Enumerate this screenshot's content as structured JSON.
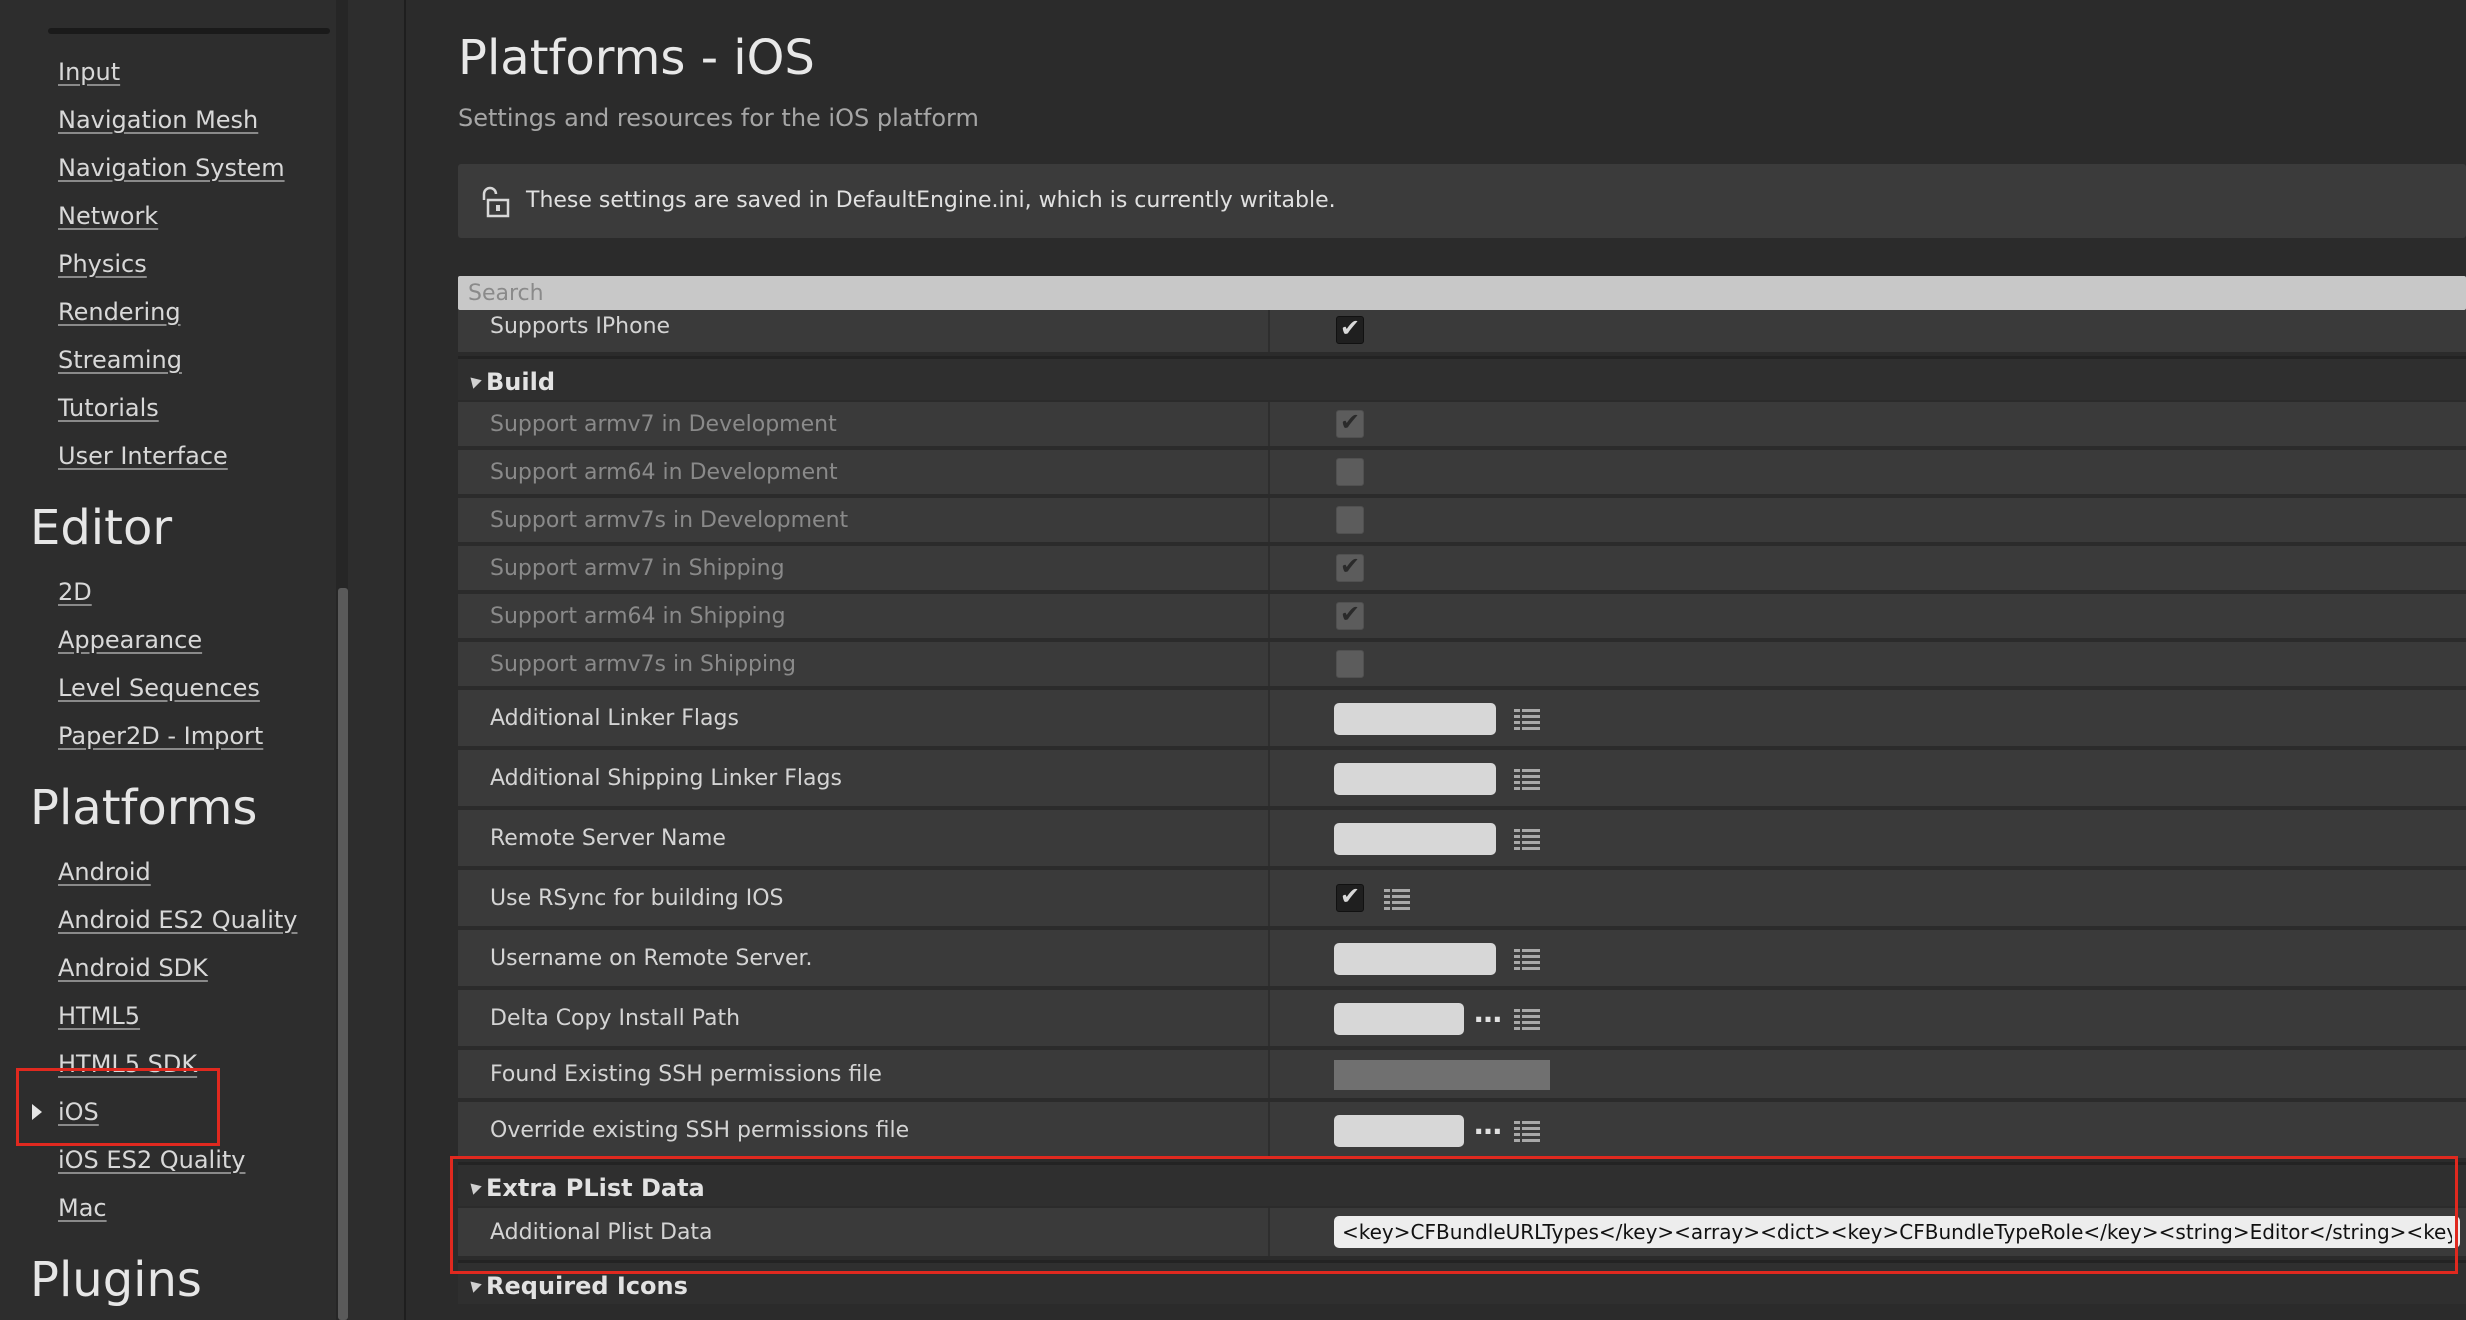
{
  "sidebar": {
    "groups": [
      {
        "category": "",
        "items": [
          "Input",
          "Navigation Mesh",
          "Navigation System",
          "Network",
          "Physics",
          "Rendering",
          "Streaming",
          "Tutorials",
          "User Interface"
        ]
      },
      {
        "category": "Editor",
        "items": [
          "2D",
          "Appearance",
          "Level Sequences",
          "Paper2D - Import"
        ]
      },
      {
        "category": "Platforms",
        "items": [
          "Android",
          "Android ES2 Quality",
          "Android SDK",
          "HTML5",
          "HTML5 SDK",
          "iOS",
          "iOS ES2 Quality",
          "Mac"
        ]
      },
      {
        "category": "Plugins",
        "items": []
      }
    ],
    "selected": "iOS"
  },
  "header": {
    "title": "Platforms - iOS",
    "subtitle": "Settings and resources for the iOS platform"
  },
  "notice": {
    "text": "These settings are saved in DefaultEngine.ini, which is currently writable.",
    "icon": "unlocked-lock-icon"
  },
  "search": {
    "placeholder": "Search"
  },
  "rows": {
    "supports_iphone": {
      "label": "Supports IPhone",
      "checked": true
    },
    "build": {
      "title": "Build",
      "armv7_dev": {
        "label": "Support armv7 in Development",
        "checked": true
      },
      "arm64_dev": {
        "label": "Support arm64 in Development",
        "checked": false
      },
      "armv7s_dev": {
        "label": "Support armv7s in Development",
        "checked": false
      },
      "armv7_ship": {
        "label": "Support armv7 in Shipping",
        "checked": true
      },
      "arm64_ship": {
        "label": "Support arm64 in Shipping",
        "checked": true
      },
      "armv7s_ship": {
        "label": "Support armv7s in Shipping",
        "checked": false
      },
      "linker_flags": {
        "label": "Additional Linker Flags",
        "value": ""
      },
      "ship_linker_flags": {
        "label": "Additional Shipping Linker Flags",
        "value": ""
      },
      "remote_server": {
        "label": "Remote Server Name",
        "value": ""
      },
      "rsync": {
        "label": "Use RSync for building IOS",
        "checked": true
      },
      "username": {
        "label": "Username on Remote Server.",
        "value": ""
      },
      "delta_copy": {
        "label": "Delta Copy Install Path",
        "value": ""
      },
      "ssh_found": {
        "label": "Found Existing SSH permissions file",
        "value": ""
      },
      "ssh_override": {
        "label": "Override existing SSH permissions file",
        "value": ""
      }
    },
    "extra_plist": {
      "title": "Extra PList Data",
      "additional": {
        "label": "Additional Plist Data",
        "value": "<key>CFBundleURLTypes</key><array><dict><key>CFBundleTypeRole</key><string>Editor</string><key>CFBund"
      }
    },
    "required_icons": {
      "title": "Required Icons"
    }
  },
  "colors": {
    "highlight_box": "#e0291f",
    "panel_bg": "#3a3a3a",
    "app_bg": "#2b2b2b"
  }
}
